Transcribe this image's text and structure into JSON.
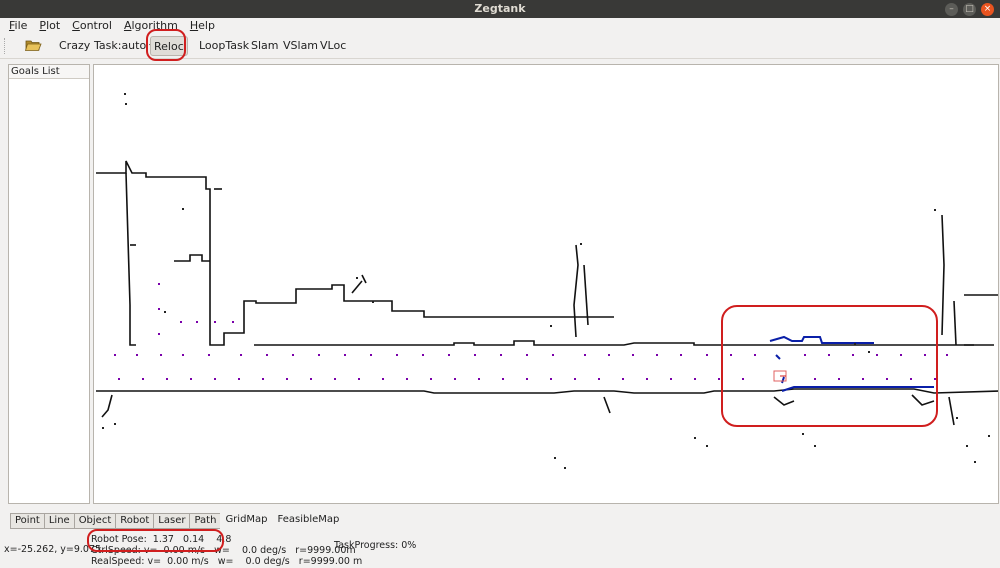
{
  "window": {
    "title": "Zegtank"
  },
  "menu": [
    {
      "key": "F",
      "rest": "ile"
    },
    {
      "key": "P",
      "rest": "lot"
    },
    {
      "key": "C",
      "rest": "ontrol"
    },
    {
      "key": "A",
      "rest": "lgorithm"
    },
    {
      "key": "H",
      "rest": "elp"
    }
  ],
  "toolbar": {
    "open_icon": "folder-open-icon",
    "crazy": "Crazy",
    "task": "Task:auto",
    "reloc": "Reloc",
    "looptask": "LoopTask",
    "slam": "Slam",
    "vslam": "VSlam",
    "vloc": "VLoc"
  },
  "goals": {
    "header": "Goals List"
  },
  "tabs": [
    "Point",
    "Line",
    "Object",
    "Robot",
    "Laser",
    "Path"
  ],
  "tabs_plain": [
    "GridMap",
    "FeasibleMap"
  ],
  "status": {
    "cursor": "x=-25.262, y=9.075",
    "robot_pose": "Robot Pose:  1.37   0.14    4.8",
    "ctrl_speed": "CtrlSpeed: v=  0.00 m/s   w=    0.0 deg/s   r=9999.00m",
    "real_speed": "RealSpeed: v=  0.00 m/s   w=    0.0 deg/s   r=9999.00 m",
    "task_progress": "TaskProgress: 0%"
  },
  "colors": {
    "titlebar": "#393937",
    "close_button": "#e95420",
    "annotation": "#d01e1e",
    "path_points": "#7a00aa",
    "laser_scan": "#0a1fa8",
    "map_walls": "#111111"
  }
}
